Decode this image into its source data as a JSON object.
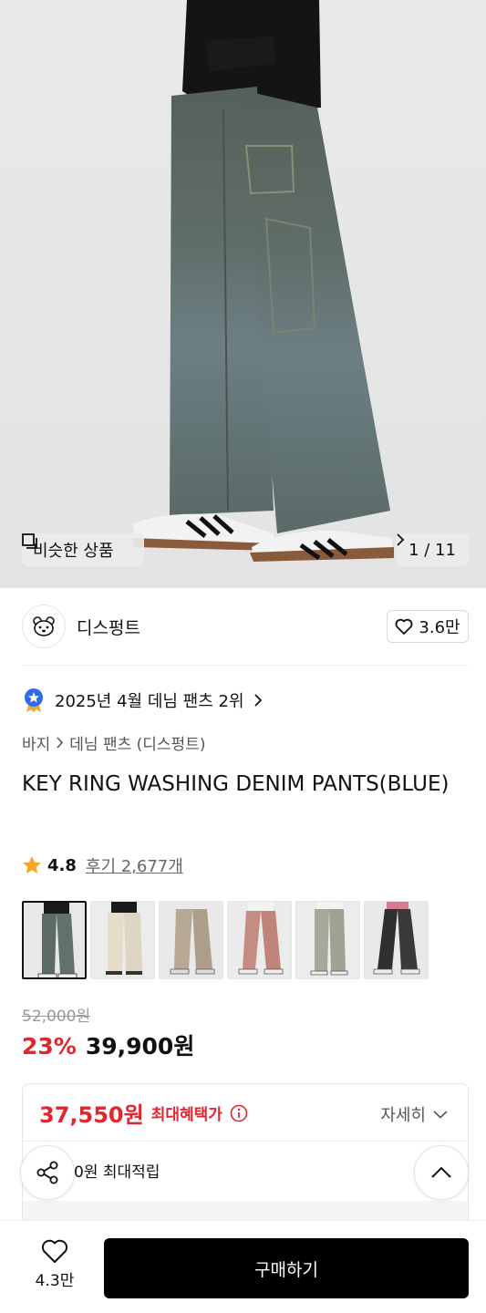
{
  "hero": {
    "similar_label": "비슷한 상품",
    "pager": "1 / 11"
  },
  "shop": {
    "name": "디스펑트",
    "like_count": "3.6만"
  },
  "ranking": {
    "text": "2025년 4월 데님 팬츠 2위"
  },
  "breadcrumb": {
    "level1": "바지",
    "level2": "데님 팬츠 (디스펑트)"
  },
  "product": {
    "title": "KEY RING WASHING DENIM PANTS(BLUE)"
  },
  "rating": {
    "score": "4.8",
    "reviews": "후기 2,677개"
  },
  "thumbnails": [
    {
      "name": "blue"
    },
    {
      "name": "ivory"
    },
    {
      "name": "beige"
    },
    {
      "name": "pink"
    },
    {
      "name": "grey"
    },
    {
      "name": "black"
    }
  ],
  "price": {
    "original": "52,000원",
    "discount_rate": "23%",
    "sale": "39,900원"
  },
  "benefit": {
    "max_price": "37,550원",
    "max_label": "최대혜택가",
    "detail_label": "자세히",
    "points": "0원 최대적립"
  },
  "bottom": {
    "wish_count": "4.3만",
    "buy_label": "구매하기"
  },
  "colors": {
    "accent_red": "#e0262f",
    "rank_badge": "#2f6be8",
    "star": "#f5a623"
  },
  "icons": [
    "copy-icon",
    "chevron-right-icon",
    "heart-icon",
    "medal-icon",
    "star-icon",
    "info-icon",
    "chevron-down-icon",
    "share-icon",
    "chevron-up-icon"
  ]
}
